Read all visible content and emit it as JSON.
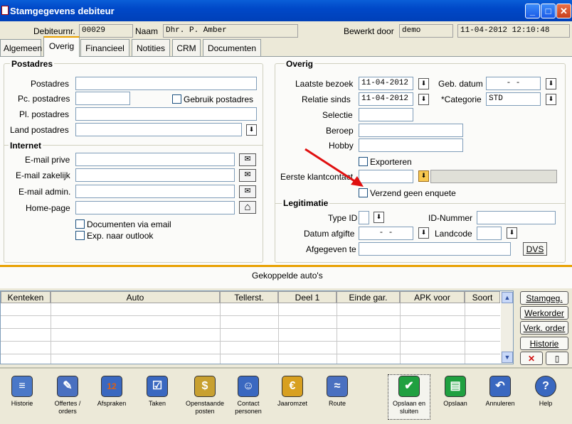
{
  "window": {
    "title": "Stamgegevens debiteur",
    "min": "_",
    "max": "□",
    "close": "✕"
  },
  "header": {
    "debnr_label": "Debiteurnr.",
    "debnr_value": "00029",
    "naam_label": "Naam",
    "naam_value": "Dhr. P. Amber",
    "bewerkt_label": "Bewerkt door",
    "bewerkt_value": "demo",
    "datetime": "11-04-2012 12:10:48"
  },
  "tabs": [
    {
      "label": "Algemeen"
    },
    {
      "label": "Overig"
    },
    {
      "label": "Financieel"
    },
    {
      "label": "Notities"
    },
    {
      "label": "CRM"
    },
    {
      "label": "Documenten"
    }
  ],
  "postadres": {
    "title": "Postadres",
    "postadres": "Postadres",
    "pc": "Pc. postadres",
    "pl": "Pl. postadres",
    "land": "Land postadres",
    "gebruik": "Gebruik postadres"
  },
  "internet": {
    "title": "Internet",
    "email_prive": "E-mail prive",
    "email_zakelijk": "E-mail zakelijk",
    "email_admin": "E-mail admin.",
    "homepage": "Home-page",
    "docs_email": "Documenten via email",
    "exp_outlook": "Exp. naar outlook"
  },
  "overig": {
    "title": "Overig",
    "laatste": "Laatste bezoek",
    "laatste_val": "11-04-2012",
    "relatie": "Relatie sinds",
    "relatie_val": "11-04-2012",
    "gebdatum": "Geb. datum",
    "gebdatum_val": "-   -",
    "categorie": "*Categorie",
    "categorie_val": "STD",
    "selectie": "Selectie",
    "beroep": "Beroep",
    "hobby": "Hobby",
    "exporteren": "Exporteren",
    "eerste": "Eerste klantcontact",
    "verzend": "Verzend geen enquete"
  },
  "legitimatie": {
    "title": "Legitimatie",
    "typeid": "Type ID",
    "idnr": "ID-Nummer",
    "datum": "Datum afgifte",
    "datum_val": "-   -",
    "landcode": "Landcode",
    "afgegeven": "Afgegeven te",
    "dvs": "DVS"
  },
  "autos": {
    "title": "Gekoppelde auto's",
    "columns": [
      "Kenteken",
      "Auto",
      "Tellerst.",
      "Deel 1",
      "Einde gar.",
      "APK voor",
      "Soort"
    ]
  },
  "side_buttons": [
    "Stamgeg.",
    "Werkorder",
    "Verk. order",
    "Historie"
  ],
  "toolbar": [
    {
      "label": "Historie",
      "icon": "scroll-icon"
    },
    {
      "label": "Offertes / orders",
      "icon": "document-icon"
    },
    {
      "label": "Afspraken",
      "icon": "calendar-icon"
    },
    {
      "label": "Taken",
      "icon": "clipboard-icon"
    },
    {
      "label": "Openstaande posten",
      "icon": "coins-icon"
    },
    {
      "label": "Contact personen",
      "icon": "people-icon"
    },
    {
      "label": "Jaaromzet",
      "icon": "euro-icon"
    },
    {
      "label": "Route",
      "icon": "road-icon"
    },
    {
      "label": "Opslaan en sluiten",
      "icon": "check-icon"
    },
    {
      "label": "Opslaan",
      "icon": "floppy-icon"
    },
    {
      "label": "Annuleren",
      "icon": "undo-icon"
    },
    {
      "label": "Help",
      "icon": "help-icon"
    }
  ],
  "glyphs": {
    "dd": "⬇",
    "mail": "✉",
    "home": "⌂",
    "up": "▲",
    "down": "▼",
    "x": "✕",
    "new": "▯",
    "cal": "12",
    "euro": "€",
    "q": "?",
    "ok": "✔",
    "undo": "↶"
  }
}
